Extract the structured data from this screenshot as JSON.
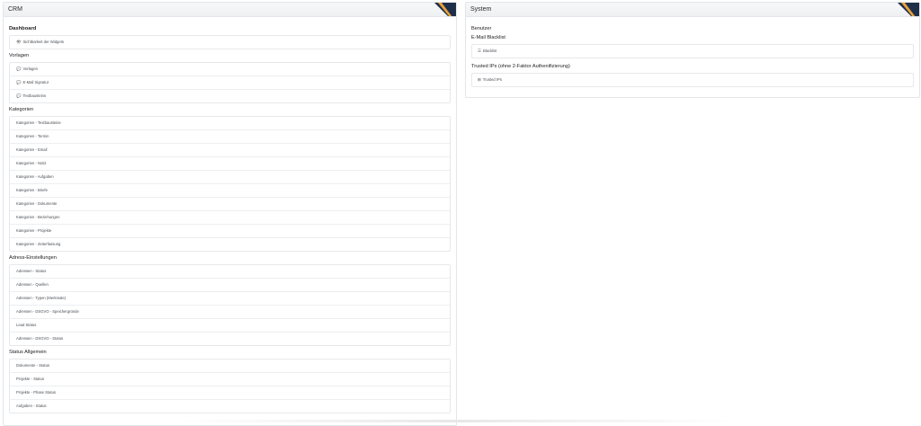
{
  "crm": {
    "title": "CRM",
    "dashboard": {
      "title": "Dashboard",
      "items": [
        {
          "label": "Sichtbarkeit der Widgets",
          "icon": "eye-icon"
        }
      ]
    },
    "vorlagen": {
      "title": "Vorlagen",
      "items": [
        {
          "label": "Vorlagen",
          "icon": "comments-icon"
        },
        {
          "label": "E-Mail Signatur",
          "icon": "comments-icon"
        },
        {
          "label": "Textbausteins",
          "icon": "comments-icon"
        }
      ]
    },
    "kategorien": {
      "title": "Kategorien",
      "items": [
        "Kategorien - Textbausteine",
        "Kategorien - Termin",
        "Kategorien - Email",
        "Kategorien - Notiz",
        "Kategorien - Aufgaben",
        "Kategorien - Briefe",
        "Kategorien - Dokumente",
        "Kategorien - Beziehungen",
        "Kategorien - Projekte",
        "Kategorien - Zeiterfassung"
      ]
    },
    "adress": {
      "title": "Adress-Einstellungen",
      "items": [
        "Adressen - Status",
        "Adressen - Quellen",
        "Adressen - Typen (Merkmale)",
        "Adressen - DSGVO - Speichergründe",
        "Lead Status",
        "Adressen - DSGVO - Status"
      ]
    },
    "status": {
      "title": "Status Allgemein",
      "items": [
        "Dokumente - Status",
        "Projekte - Status",
        "Projekte - Phase Status",
        "Aufgaben - Status"
      ]
    }
  },
  "system": {
    "title": "System",
    "benutzer_title": "Benutzer",
    "blacklist": {
      "title": "E-Mail Blacklist",
      "items": [
        {
          "label": "Blacklist",
          "icon": "list-icon"
        }
      ]
    },
    "trusted": {
      "title": "Trusted IPs (ohne 2-Faktor Authenifizierung)",
      "items": [
        {
          "label": "Trusted IPs",
          "icon": "table-icon"
        }
      ]
    }
  },
  "colors": {
    "corner_navy": "#1f2f4a",
    "corner_orange": "#e9a13b",
    "border": "#e3e6ea"
  }
}
